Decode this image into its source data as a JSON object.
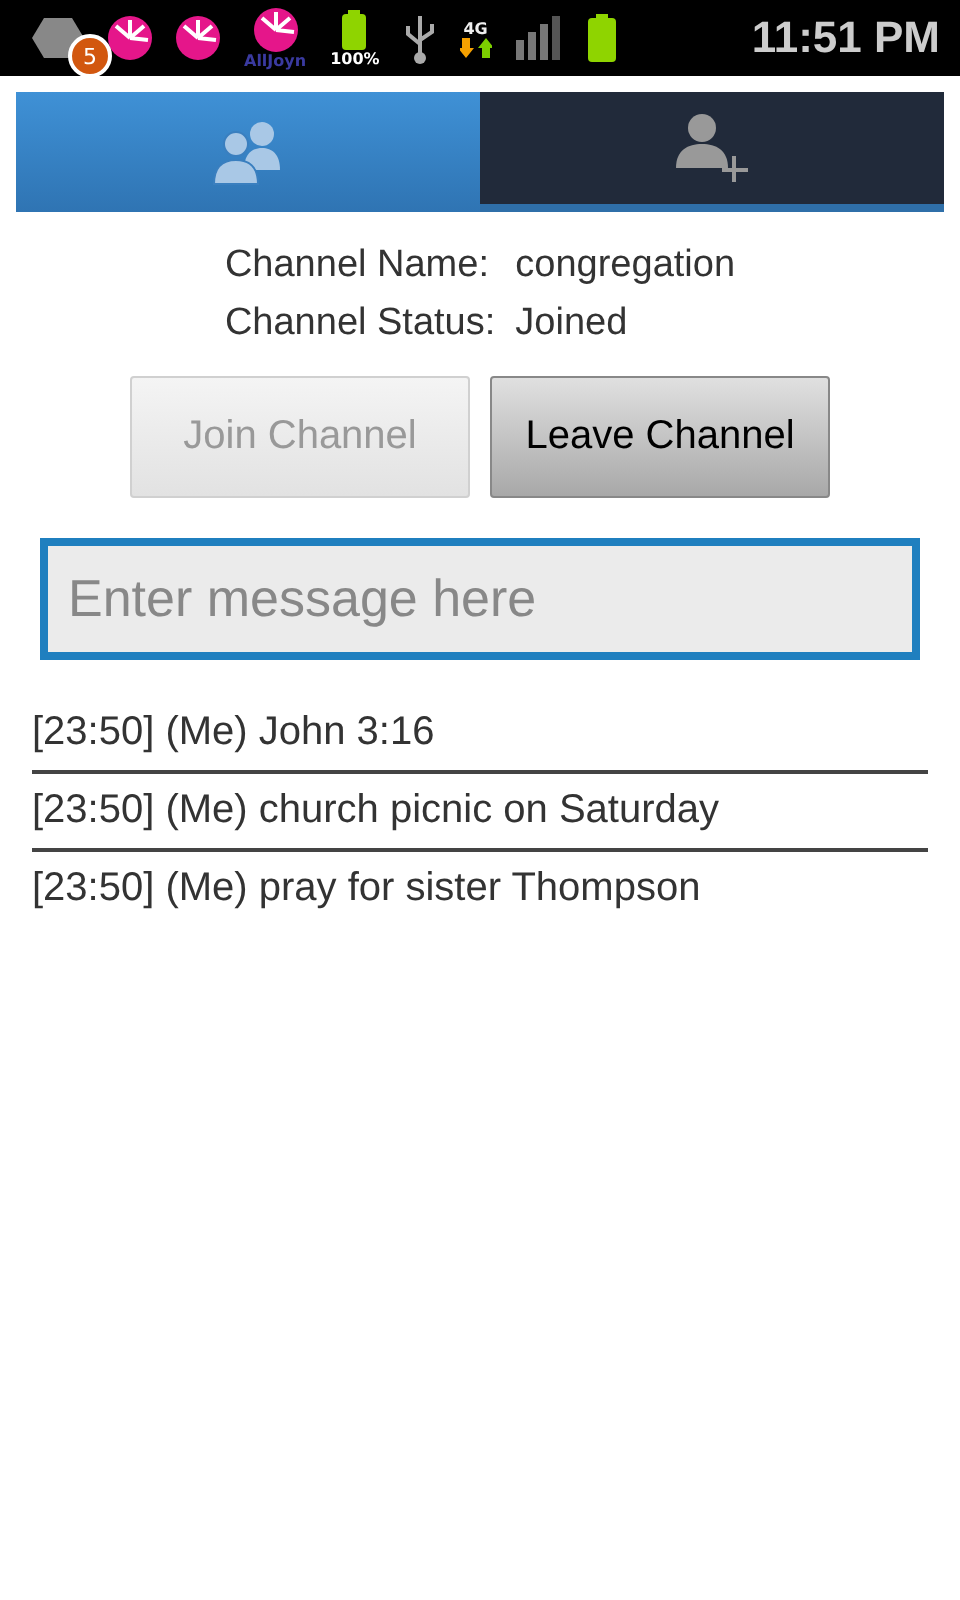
{
  "status_bar": {
    "badge": "5",
    "app_label": "AllJoyn",
    "battery_percent": "100%",
    "network": "4G",
    "time": "11:51 PM"
  },
  "tabs": [
    {
      "kind": "group",
      "selected": true
    },
    {
      "kind": "add",
      "selected": false
    }
  ],
  "channel": {
    "name_label": "Channel Name:",
    "name": "congregation",
    "status_label": "Channel Status:",
    "status": "Joined"
  },
  "buttons": [
    {
      "label": "Join Channel",
      "disabled": true
    },
    {
      "label": "Leave Channel",
      "disabled": false
    }
  ],
  "message_field": {
    "placeholder": "Enter message here",
    "focused": true
  },
  "messages": [
    "[23:50] (Me) John 3:16",
    "[23:50] (Me) church picnic on Saturday",
    "[23:50] (Me) pray for sister Thompson"
  ]
}
